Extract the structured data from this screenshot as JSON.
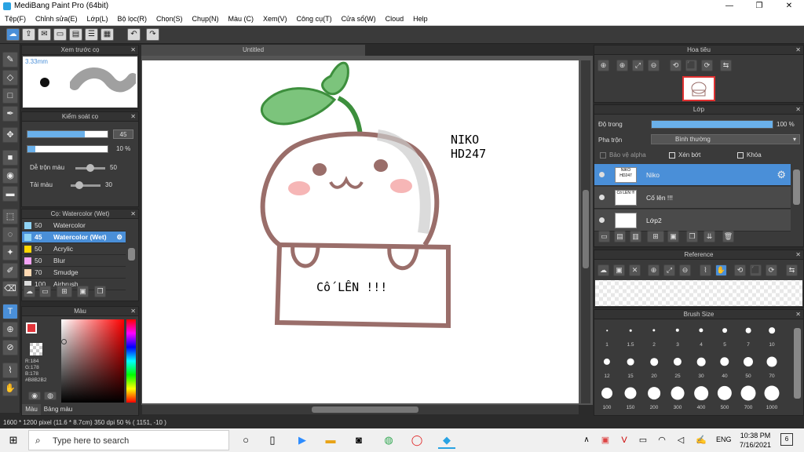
{
  "window": {
    "title": "MediBang Paint Pro (64bit)",
    "min": "—",
    "max": "❐",
    "close": "✕"
  },
  "menu": [
    "Tệp(F)",
    "Chỉnh sửa(E)",
    "Lớp(L)",
    "Bộ lọc(R)",
    "Chọn(S)",
    "Chụp(N)",
    "Màu (C)",
    "Xem(V)",
    "Công cụ(T)",
    "Cửa sổ(W)",
    "Cloud",
    "Help"
  ],
  "canvas_tab": "Untitled",
  "brush_preview": {
    "title": "Xem trước cọ",
    "size": "3.33mm"
  },
  "brush_control": {
    "title": "Kiểm soát cọ",
    "size_value": "45",
    "opacity_value": "10 %",
    "blend_label": "Dễ trộn màu",
    "blend_value": "50",
    "reload_label": "Tải màu",
    "reload_value": "30"
  },
  "brush_list": {
    "title": "Cọ: Watercolor (Wet)",
    "items": [
      {
        "size": "50",
        "name": "Watercolor",
        "color": "#8fd3f5"
      },
      {
        "size": "45",
        "name": "Watercolor (Wet)",
        "color": "#8fd3f5"
      },
      {
        "size": "50",
        "name": "Acrylic",
        "color": "#ffd700"
      },
      {
        "size": "50",
        "name": "Blur",
        "color": "#f5a3f5"
      },
      {
        "size": "70",
        "name": "Smudge",
        "color": "#ffd9b3"
      },
      {
        "size": "100",
        "name": "Airbrush",
        "color": "#dddddd"
      }
    ]
  },
  "color_panel": {
    "title": "Màu",
    "r": "R:184",
    "g": "G:178",
    "b": "B:178",
    "hex": "#B8B2B2",
    "tab_color": "Màu",
    "tab_palette": "Bảng màu",
    "primary": "#e3343a"
  },
  "status": {
    "dimensions": "1600 * 1200 pixel",
    "physical": "(11.6 * 8.7cm)",
    "dpi": "350 dpi",
    "zoom": "50 %",
    "coords": "( 1151, -10 )"
  },
  "navigator": {
    "title": "Hoa tiêu"
  },
  "layers": {
    "title": "Lớp",
    "opacity_label": "Độ trong",
    "opacity_value": "100 %",
    "opacity_fraction": 1.0,
    "blend_label": "Pha trộn",
    "blend_value": "Bình thường",
    "protect_alpha": "Bảo vệ alpha",
    "clipping": "Xén bớt",
    "lock": "Khóa",
    "items": [
      {
        "name": "Niko",
        "thumb": "NIKO HD247",
        "selected": true
      },
      {
        "name": "Cố lên !!!",
        "thumb": "Cố LÊN !!!",
        "selected": false
      },
      {
        "name": "Lớp2",
        "thumb": "",
        "selected": false
      }
    ]
  },
  "reference": {
    "title": "Reference"
  },
  "brush_size": {
    "title": "Brush Size",
    "sizes": [
      "1",
      "1.5",
      "2",
      "3",
      "4",
      "5",
      "7",
      "10",
      "12",
      "15",
      "20",
      "25",
      "30",
      "40",
      "50",
      "70",
      "100",
      "150",
      "200",
      "300",
      "400",
      "500",
      "700",
      "1000"
    ]
  },
  "artwork": {
    "text_niko": "NIKO",
    "text_hd": "HD247",
    "text_sign": "Cố LÊN !!!"
  },
  "taskbar": {
    "search_placeholder": "Type here to search",
    "time": "10:38 PM",
    "date": "7/16/2021",
    "lang": "ENG",
    "notif": "6"
  }
}
